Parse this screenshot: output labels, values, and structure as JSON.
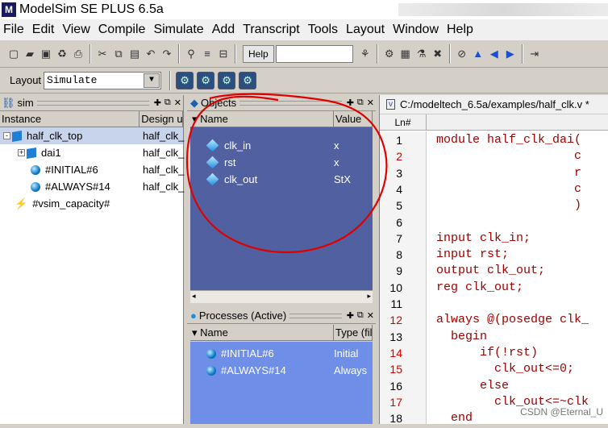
{
  "window": {
    "title": "ModelSim SE PLUS 6.5a"
  },
  "menu": [
    "File",
    "Edit",
    "View",
    "Compile",
    "Simulate",
    "Add",
    "Transcript",
    "Tools",
    "Layout",
    "Window",
    "Help"
  ],
  "toolbar": {
    "help_label": "Help",
    "help_value": ""
  },
  "layout_bar": {
    "label": "Layout",
    "value": "Simulate"
  },
  "sim_pane": {
    "title": "sim",
    "columns": [
      "Instance",
      "Design u"
    ],
    "rows": [
      {
        "name": "half_clk_top",
        "design": "half_clk_",
        "icon": "module-icon",
        "expander": "-"
      },
      {
        "name": "dai1",
        "design": "half_clk_",
        "icon": "module-icon",
        "expander": "+"
      },
      {
        "name": "#INITIAL#6",
        "design": "half_clk_",
        "icon": "process-icon",
        "expander": ""
      },
      {
        "name": "#ALWAYS#14",
        "design": "half_clk_",
        "icon": "process-icon",
        "expander": ""
      },
      {
        "name": "#vsim_capacity#",
        "design": "",
        "icon": "capacity-icon",
        "expander": ""
      }
    ]
  },
  "objects_pane": {
    "title": "Objects",
    "columns": [
      "Name",
      "Value"
    ],
    "rows": [
      {
        "name": "clk_in",
        "value": "x"
      },
      {
        "name": "rst",
        "value": "x"
      },
      {
        "name": "clk_out",
        "value": "StX"
      }
    ]
  },
  "processes_pane": {
    "title": "Processes (Active)",
    "columns": [
      "Name",
      "Type (fil"
    ],
    "rows": [
      {
        "name": "#INITIAL#6",
        "type": "Initial"
      },
      {
        "name": "#ALWAYS#14",
        "type": "Always"
      }
    ]
  },
  "source_pane": {
    "path": "C:/modeltech_6.5a/examples/half_clk.v *",
    "column": "Ln#",
    "lines": [
      {
        "n": "1",
        "text": "module half_clk_dai(",
        "red": false
      },
      {
        "n": "2",
        "text": "                   c",
        "red": true
      },
      {
        "n": "3",
        "text": "                   r",
        "red": false
      },
      {
        "n": "4",
        "text": "                   c",
        "red": false
      },
      {
        "n": "5",
        "text": "                   )",
        "red": false
      },
      {
        "n": "6",
        "text": "",
        "red": false
      },
      {
        "n": "7",
        "text": "input clk_in;",
        "red": false
      },
      {
        "n": "8",
        "text": "input rst;",
        "red": false
      },
      {
        "n": "9",
        "text": "output clk_out;",
        "red": false
      },
      {
        "n": "10",
        "text": "reg clk_out;",
        "red": false
      },
      {
        "n": "11",
        "text": "",
        "red": false
      },
      {
        "n": "12",
        "text": "always @(posedge clk_",
        "red": true
      },
      {
        "n": "13",
        "text": "  begin",
        "red": false
      },
      {
        "n": "14",
        "text": "      if(!rst)",
        "red": true
      },
      {
        "n": "15",
        "text": "        clk_out<=0;",
        "red": true
      },
      {
        "n": "16",
        "text": "      else",
        "red": false
      },
      {
        "n": "17",
        "text": "        clk_out<=~clk",
        "red": true
      },
      {
        "n": "18",
        "text": "  end",
        "red": false
      }
    ]
  },
  "watermark": "CSDN @Eternal_U",
  "colors": {
    "objects_bg": "#5160a0",
    "processes_bg": "#6f8ee8",
    "annotation": "#e00000",
    "keyword": "#a00000",
    "line_red": "#d00000"
  }
}
